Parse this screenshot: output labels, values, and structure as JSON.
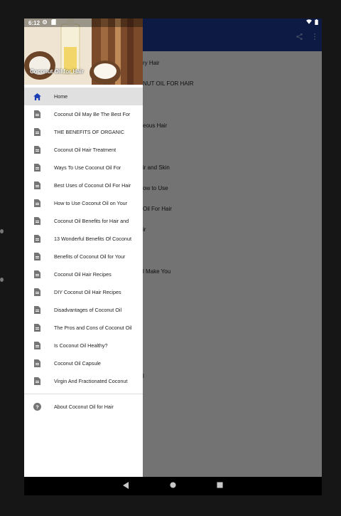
{
  "status": {
    "time": "6:12"
  },
  "drawer": {
    "title": "Coconut Oil for Hair",
    "items": [
      {
        "label": "Home",
        "icon": "home-icon"
      },
      {
        "label": "Coconut Oil May Be The Best For",
        "icon": "document-icon"
      },
      {
        "label": "THE BENEFITS OF ORGANIC",
        "icon": "document-icon"
      },
      {
        "label": "Coconut Oil Hair Treatment",
        "icon": "document-icon"
      },
      {
        "label": "Ways To Use Coconut Oil For",
        "icon": "document-icon"
      },
      {
        "label": "Best Uses of Coconut Oil For Hair",
        "icon": "document-icon"
      },
      {
        "label": "How to Use Coconut Oil on Your",
        "icon": "document-icon"
      },
      {
        "label": "Coconut Oil Benefits for Hair and",
        "icon": "document-icon"
      },
      {
        "label": "13 Wonderful Benefits Of Coconut",
        "icon": "document-icon"
      },
      {
        "label": "Benefits of Coconut Oil for Your",
        "icon": "document-icon"
      },
      {
        "label": "Coconut Oil Hair Recipes",
        "icon": "document-icon"
      },
      {
        "label": "DIY Coconut Oil Hair Recipes",
        "icon": "document-icon"
      },
      {
        "label": "Disadvantages of Coconut Oil",
        "icon": "document-icon"
      },
      {
        "label": "The Pros and Cons of Coconut Oil",
        "icon": "document-icon"
      },
      {
        "label": "Is Coconut Oil Healthy?",
        "icon": "document-icon"
      },
      {
        "label": "Coconut Oil Capsule",
        "icon": "document-icon"
      },
      {
        "label": "Virgin And Fractionated Coconut",
        "icon": "document-icon"
      }
    ],
    "about": {
      "label": "About Coconut Oil for Hair",
      "icon": "help-icon"
    }
  },
  "background_list": [
    "ry Hair",
    "NUT OIL FOR HAIR",
    "",
    "eous Hair",
    "",
    "ir and Skin",
    "ow to Use",
    "Oil For Hair",
    "ir",
    "",
    "l Make You",
    "",
    "",
    "",
    "",
    "l"
  ],
  "colors": {
    "appbar": "#1b3a97",
    "active_icon": "#1a3db5"
  }
}
